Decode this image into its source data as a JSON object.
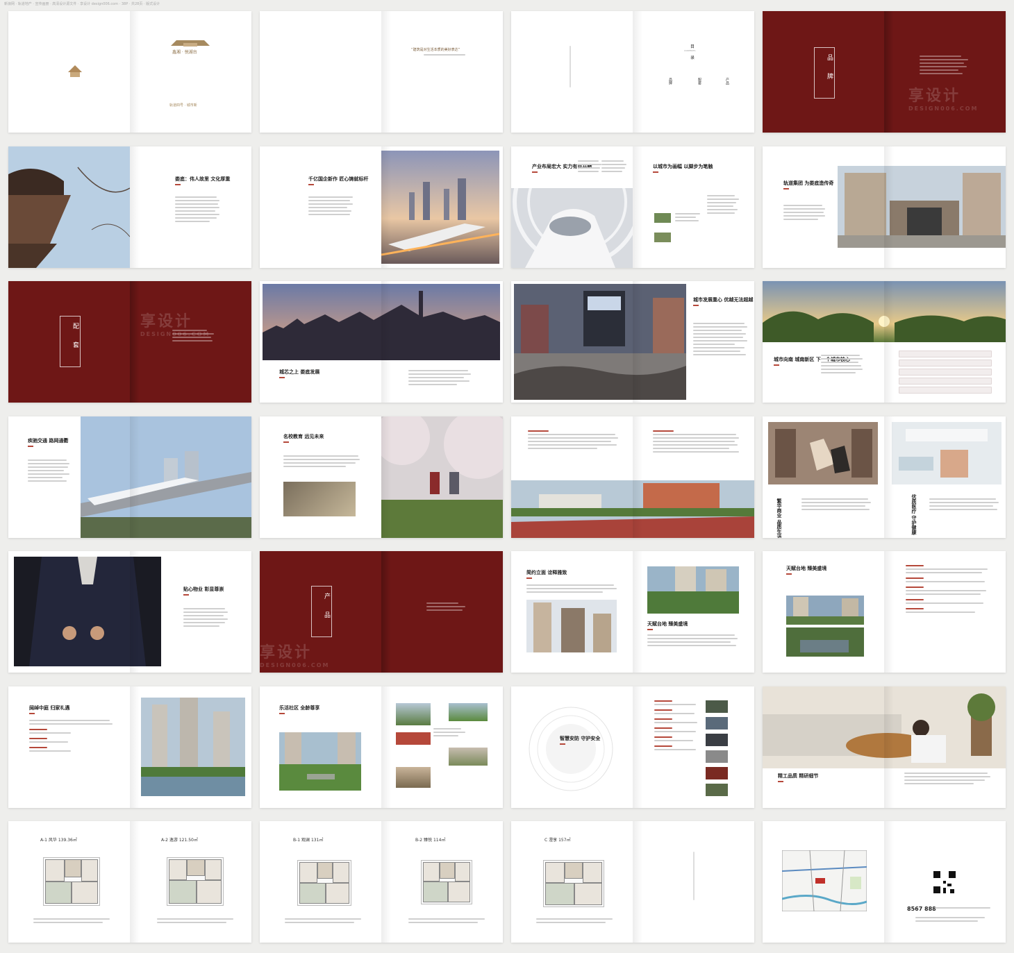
{
  "header_note": "新浪网 · 轨道地产 · 宣传画册 · 高清设计源文件 · 享设计 design006.com · 38P · 共28页 · 版式设计",
  "watermark": {
    "main": "享设计",
    "sub": "DESIGN006.COM"
  },
  "cover": {
    "brand": "鑫湘 · 悦湖台",
    "tagline": "轨道四号 · 城市新"
  },
  "toc": {
    "heading_top": "目",
    "heading_bottom": "录",
    "contents": "CONTENTS",
    "items": [
      "品牌",
      "配套",
      "产品"
    ]
  },
  "sections": {
    "brand": [
      "品",
      "牌"
    ],
    "facility": [
      "配",
      "套"
    ],
    "product": [
      "产",
      "品"
    ]
  },
  "quote": "“建筑是对生活本质的美好表达”",
  "titles": {
    "heritage": "娄底：伟人故里 文化厚重",
    "bigco": "千亿国企新作 匠心铸就标杆",
    "industry": "产业布局宏大 实力有目共睹",
    "city_brush": "以城市为画幅 以脚步为笔触",
    "rail_group": "轨道集团 为娄底造传奇",
    "core": "城芯之上 娄底发展",
    "center": "城市发展重心 优越无法超越",
    "south": "城市向南 城南新区 下一个城市核心",
    "traffic": "疾驰交通 路网通衢",
    "school": "名校教育 远见未来",
    "shopping": "繁华商业 品质生活",
    "medical": "优质医疗 守护健康",
    "property": "贴心物业 彰显尊崇",
    "facade": "简约立面 诠释雅致",
    "landscape": "天赋台地 臻美盛境",
    "courtyard": "阔绰中庭 归家礼遇",
    "community": "乐活社区 全龄尊享",
    "security": "智慧安防 守护安全",
    "quality": "精工品质 精研细节"
  },
  "units": [
    {
      "code": "A-1",
      "name": "风华",
      "area": "139.36㎡",
      "layout": "四室两厅两卫"
    },
    {
      "code": "A-2",
      "name": "逸游",
      "area": "121.50㎡",
      "layout": "四室两厅两卫"
    },
    {
      "code": "B-1",
      "name": "观澜",
      "area": "131㎡",
      "layout": "三室两厅两卫"
    },
    {
      "code": "B-2",
      "name": "臻悦",
      "area": "114㎡",
      "layout": "三室两厅两卫"
    },
    {
      "code": "C",
      "name": "澄享",
      "area": "157㎡",
      "layout": "四室两厅三卫"
    }
  ],
  "contact": {
    "hotline": "8567 888"
  },
  "colors": {
    "brand_red": "#6e1716",
    "accent": "#b5483a",
    "gold": "#a68a5f"
  }
}
